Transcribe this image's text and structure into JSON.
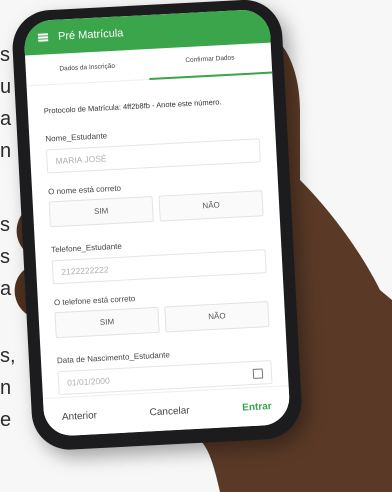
{
  "background_text": {
    "lines": [
      "s",
      "u",
      "a",
      "n",
      "s",
      "s",
      "a",
      "s,",
      "n",
      "e"
    ]
  },
  "app": {
    "title": "Pré Matrícula",
    "accent": "#3aa54a"
  },
  "tabs": [
    {
      "label": "Dados da Inscrição"
    },
    {
      "label": "Confirmar Dados"
    }
  ],
  "form": {
    "protocol_text": "Protocolo de Matrícula: 4ff2b8fb - Anote este número.",
    "name_label": "Nome_Estudante",
    "name_value": "MARIA JOSÉ",
    "name_check_label": "O nome está correto",
    "yes_label": "SIM",
    "no_label": "NÃO",
    "phone_label": "Telefone_Estudante",
    "phone_value": "2122222222",
    "phone_check_label": "O telefone está correto",
    "birth_label": "Data de Nascimento_Estudante",
    "birth_value": "01/01/2000"
  },
  "footer": {
    "previous": "Anterior",
    "cancel": "Cancelar",
    "enter": "Entrar"
  }
}
